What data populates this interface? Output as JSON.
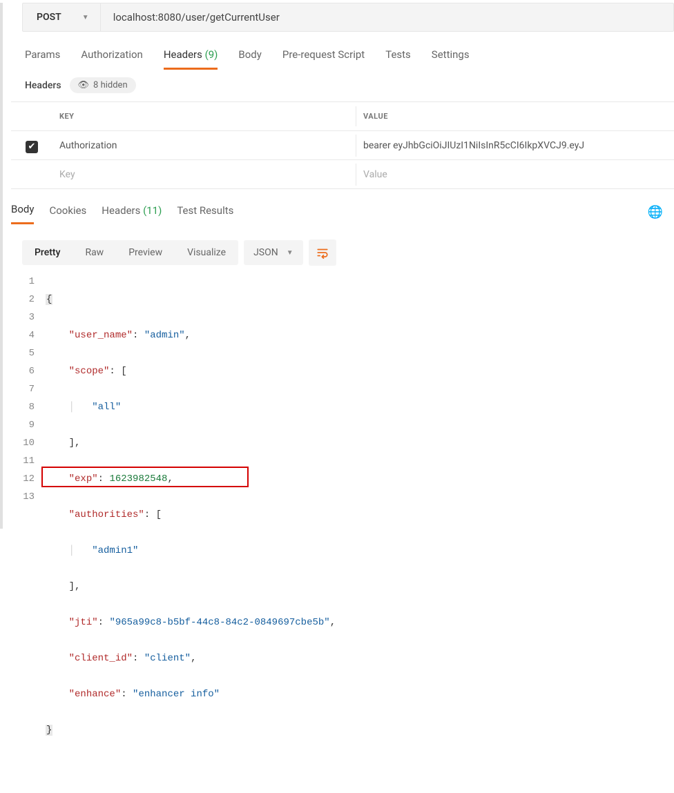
{
  "request": {
    "method": "POST",
    "url": "localhost:8080/user/getCurrentUser",
    "tabs": {
      "params": "Params",
      "auth": "Authorization",
      "headers": "Headers",
      "headers_count": "(9)",
      "body": "Body",
      "prereq": "Pre-request Script",
      "tests": "Tests",
      "settings": "Settings"
    },
    "headers_label": "Headers",
    "hidden_pill": "8 hidden",
    "columns": {
      "key": "KEY",
      "value": "VALUE"
    },
    "rows": [
      {
        "checked": true,
        "key": "Authorization",
        "value": "bearer eyJhbGciOiJIUzI1NiIsInR5cCI6IkpXVCJ9.eyJ"
      }
    ],
    "placeholders": {
      "key": "Key",
      "value": "Value"
    }
  },
  "response": {
    "tabs": {
      "body": "Body",
      "cookies": "Cookies",
      "headers": "Headers",
      "headers_count": "(11)",
      "test_results": "Test Results"
    },
    "toolbar": {
      "pretty": "Pretty",
      "raw": "Raw",
      "preview": "Preview",
      "visualize": "Visualize",
      "format": "JSON"
    },
    "body_json": {
      "user_name": "admin",
      "scope": [
        "all"
      ],
      "exp": 1623982548,
      "authorities": [
        "admin1"
      ],
      "jti": "965a99c8-b5bf-44c8-84c2-0849697cbe5b",
      "client_id": "client",
      "enhance": "enhancer info"
    },
    "lines": {
      "l1": "{",
      "l2_k": "\"user_name\"",
      "l2_v": "\"admin\"",
      "l3_k": "\"scope\"",
      "l4_v": "\"all\"",
      "l6_k": "\"exp\"",
      "l6_v": "1623982548",
      "l7_k": "\"authorities\"",
      "l8_v": "\"admin1\"",
      "l10_k": "\"jti\"",
      "l10_v": "\"965a99c8-b5bf-44c8-84c2-0849697cbe5b\"",
      "l11_k": "\"client_id\"",
      "l11_v": "\"client\"",
      "l12_k": "\"enhance\"",
      "l12_v": "\"enhancer info\"",
      "l13": "}"
    },
    "gutter": [
      "1",
      "2",
      "3",
      "4",
      "5",
      "6",
      "7",
      "8",
      "9",
      "10",
      "11",
      "12",
      "13"
    ]
  }
}
